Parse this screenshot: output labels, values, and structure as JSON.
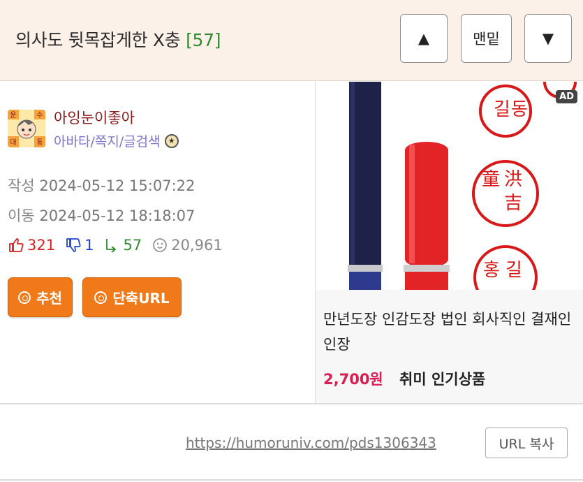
{
  "header": {
    "title": "의사도 뒷목잡게한 X충",
    "comment_count": "[57]",
    "up_button": "▲",
    "bottom_button": "맨밑",
    "down_button": "▼"
  },
  "user": {
    "nickname": "아잉눈이좋아",
    "links": "아바타/쪽지/글검색",
    "avatar_chars": [
      "운",
      "수",
      "대",
      "통"
    ]
  },
  "meta": {
    "written_label": "작성",
    "written_value": "2024-05-12 15:07:22",
    "moved_label": "이동",
    "moved_value": "2024-05-12 18:18:07"
  },
  "stats": {
    "likes": "321",
    "dislikes": "1",
    "replies": "57",
    "views": "20,961"
  },
  "buttons": {
    "recommend": "추천",
    "short_url": "단축URL"
  },
  "ad": {
    "badge": "AD",
    "title": "만년도장 인감도장 법인 회사직인 결재인 인장",
    "price": "2,700원",
    "category": "취미 인기상품",
    "stamp_chars": [
      "길",
      "동",
      "童",
      "洪",
      "吉",
      "홍",
      "길"
    ]
  },
  "footer": {
    "url": "https://humoruniv.com/pds1306343",
    "copy_label": "URL 복사"
  },
  "colors": {
    "header_bg": "#fbf1e8",
    "accent_orange": "#f07a1a",
    "count_green": "#2e8b2e",
    "price_pink": "#d81e52"
  }
}
